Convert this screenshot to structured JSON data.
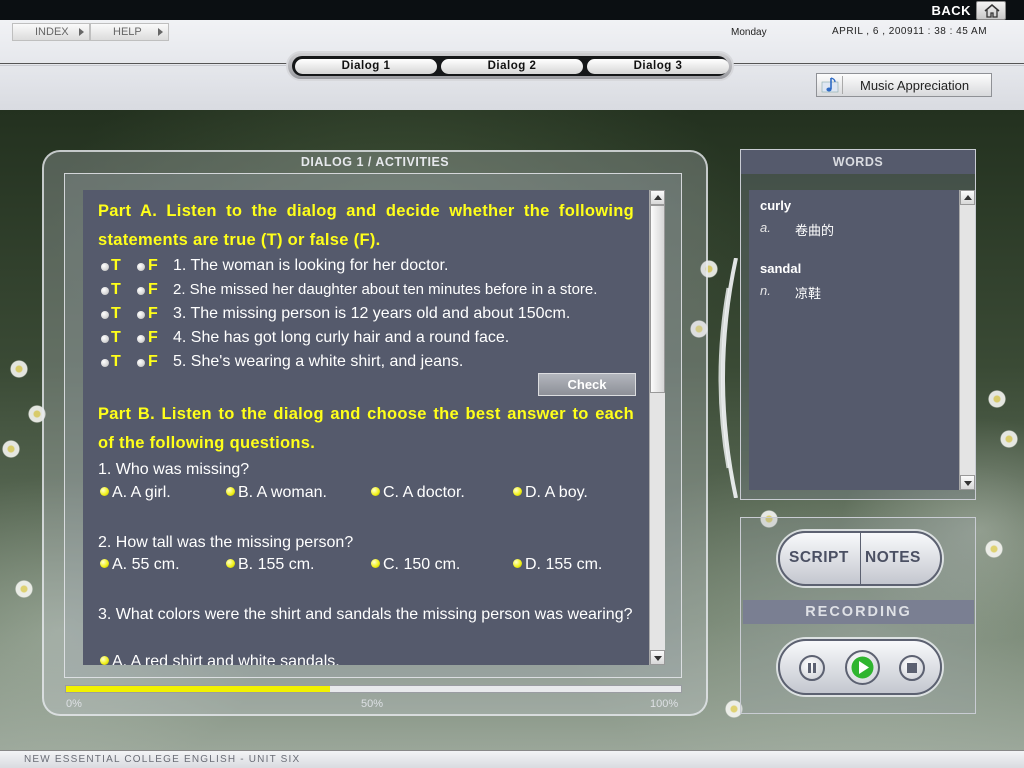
{
  "topbar": {
    "back_label": "BACK",
    "home_icon": "house-icon"
  },
  "header": {
    "index_label": "INDEX",
    "help_label": "HELP",
    "day": "Monday",
    "datetime": "APRIL ,  6 , 200911 : 38 : 45 AM",
    "tabs": [
      "Dialog 1",
      "Dialog 2",
      "Dialog 3"
    ],
    "music_label": "Music Appreciation",
    "music_icon": "music-note-icon"
  },
  "activity": {
    "title": "DIALOG 1 / ACTIVITIES",
    "part_a": {
      "heading": "Part A. Listen to the dialog and decide whether the following statements are true (T) or false (F).",
      "true_letter": "T",
      "false_letter": "F",
      "statements": [
        "1. The woman is looking for her doctor.",
        "2. She missed her daughter about ten minutes before in a store.",
        "3. The missing person is 12 years old and about 150cm.",
        "4. She has got long curly hair and a round face.",
        "5. She's wearing a white shirt, and jeans."
      ],
      "check_label": "Check"
    },
    "part_b": {
      "heading": "Part B.  Listen to the dialog and choose the best answer to each of the following questions.",
      "questions": [
        {
          "text": "1. Who was missing?",
          "options": [
            "A. A girl.",
            "B. A woman.",
            "C. A doctor.",
            "D. A boy."
          ]
        },
        {
          "text": "2. How tall was the missing person?",
          "options": [
            "A. 55 cm.",
            "B. 155 cm.",
            "C. 150 cm.",
            "D. 155 cm."
          ]
        },
        {
          "text": "3. What colors were the shirt and sandals the missing person was wearing?",
          "options": [
            "A. A red shirt and white sandals."
          ]
        }
      ]
    },
    "progress": {
      "value": 0.43,
      "labels": [
        "0%",
        "50%",
        "100%"
      ]
    }
  },
  "words": {
    "title": "WORDS",
    "entries": [
      {
        "term": "curly",
        "pos": "a.",
        "def": "卷曲的"
      },
      {
        "term": "sandal",
        "pos": "n.",
        "def": "凉鞋"
      }
    ]
  },
  "media": {
    "script_label": "SCRIPT",
    "notes_label": "NOTES",
    "recording_label": "RECORDING",
    "pause_icon": "pause-icon",
    "play_icon": "play-icon",
    "stop_icon": "stop-icon"
  },
  "footer": {
    "text": "NEW ESSENTIAL COLLEGE ENGLISH - UNIT SIX"
  },
  "colors": {
    "accent_yellow": "#ffff1a",
    "panel": "#555a6c",
    "play_green": "#2fb52f"
  }
}
